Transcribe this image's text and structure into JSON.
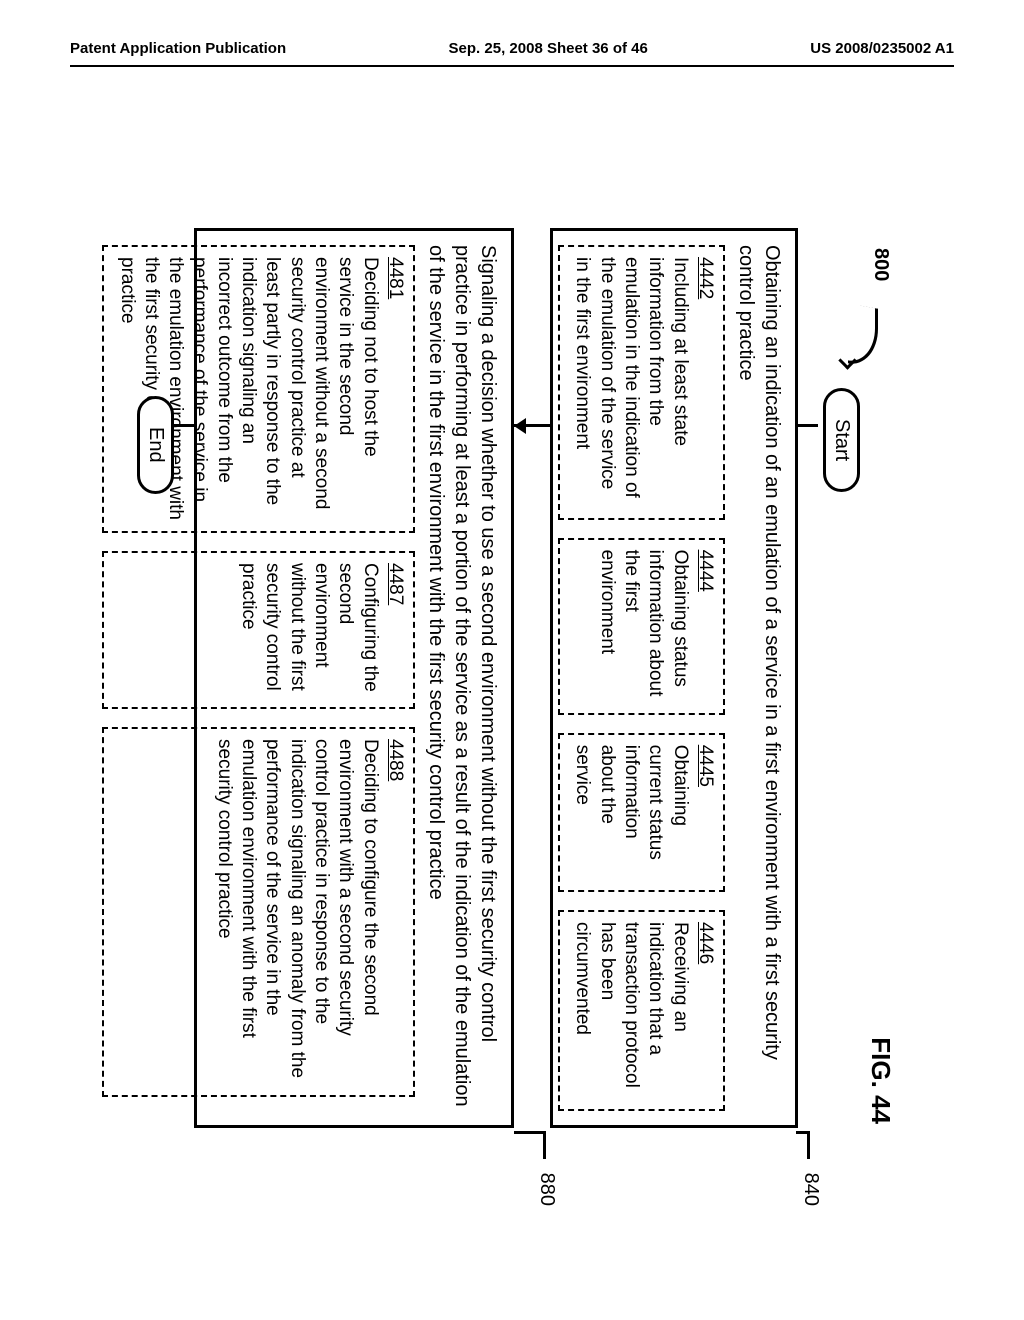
{
  "header": {
    "left": "Patent Application Publication",
    "center": "Sep. 25, 2008  Sheet 36 of 46",
    "right": "US 2008/0235002 A1"
  },
  "figure": {
    "ref": "800",
    "title": "FIG. 44",
    "start": "Start",
    "end": "End",
    "step840": {
      "label": "840",
      "title": "Obtaining an indication of an emulation of a service in a first environment with a first security control practice",
      "b4442": {
        "num": "4442",
        "text": "Including at least state information from the emulation in the indication of the emulation of the service in the first environment"
      },
      "b4444": {
        "num": "4444",
        "text": "Obtaining status information about the first environment"
      },
      "b4445": {
        "num": "4445",
        "text": "Obtaining current status information about the service"
      },
      "b4446": {
        "num": "4446",
        "text": "Receiving an indication that a transaction protocol has been circumvented"
      }
    },
    "step880": {
      "label": "880",
      "title": "Signaling a decision whether to use a second environment without the first security control practice in performing at least a portion of the service as a result of the indication of the emulation of the service in the first environment with the first security control practice",
      "b4481": {
        "num": "4481",
        "text": "Deciding not to host the service in the second environment without a second security control practice at least partly in response to the indication signaling an incorrect outcome from the performance of the service in the emulation environment with the first security control practice"
      },
      "b4487": {
        "num": "4487",
        "text": "Configuring the second environment without the first security control practice"
      },
      "b4488": {
        "num": "4488",
        "text": "Deciding to configure the second environment with a second security control practice in response to the indication signaling an anomaly from the performance of the service in the emulation environment with the first security control practice"
      }
    }
  }
}
